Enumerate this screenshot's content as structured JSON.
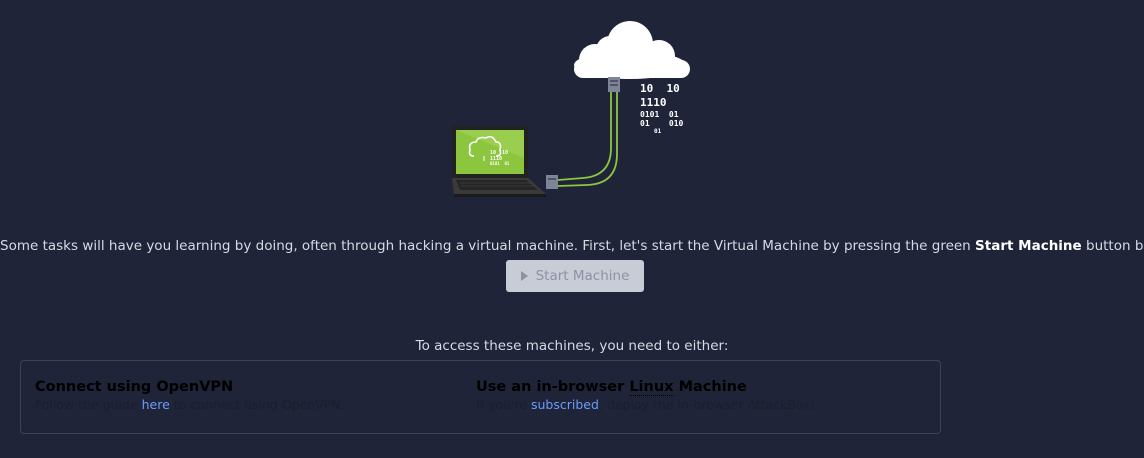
{
  "illustration": {
    "binary_lines": [
      "10  10",
      "1110",
      "0101  01",
      "01    010",
      "01"
    ],
    "screen_binary_lines": [
      "10  10",
      "1110",
      "0101  01"
    ]
  },
  "intro": {
    "before": "Some tasks will have you learning by doing, often through hacking a virtual machine. First, let's start the Virtual Machine by pressing the green ",
    "bold": "Start Machine",
    "after": " button below."
  },
  "start_button": {
    "label": "Start Machine",
    "icon": "play-icon"
  },
  "access_prompt": "To access these machines, you need to either:",
  "options": {
    "openvpn": {
      "title": "Connect using OpenVPN",
      "desc_before": "Follow the guide ",
      "link": "here",
      "desc_after": " to connect using OpenVPN."
    },
    "browser": {
      "title_before": "Use an in-browser ",
      "title_abbr": "Linux",
      "title_after": " Machine",
      "desc_before": "If you're ",
      "link": "subscribed",
      "desc_after": ", deploy the in-browser AttackBox!"
    }
  },
  "colors": {
    "background": "#1f2438",
    "accent_green": "#8cc63f",
    "link": "#6d9bff",
    "button_disabled": "#c7ccd6"
  }
}
